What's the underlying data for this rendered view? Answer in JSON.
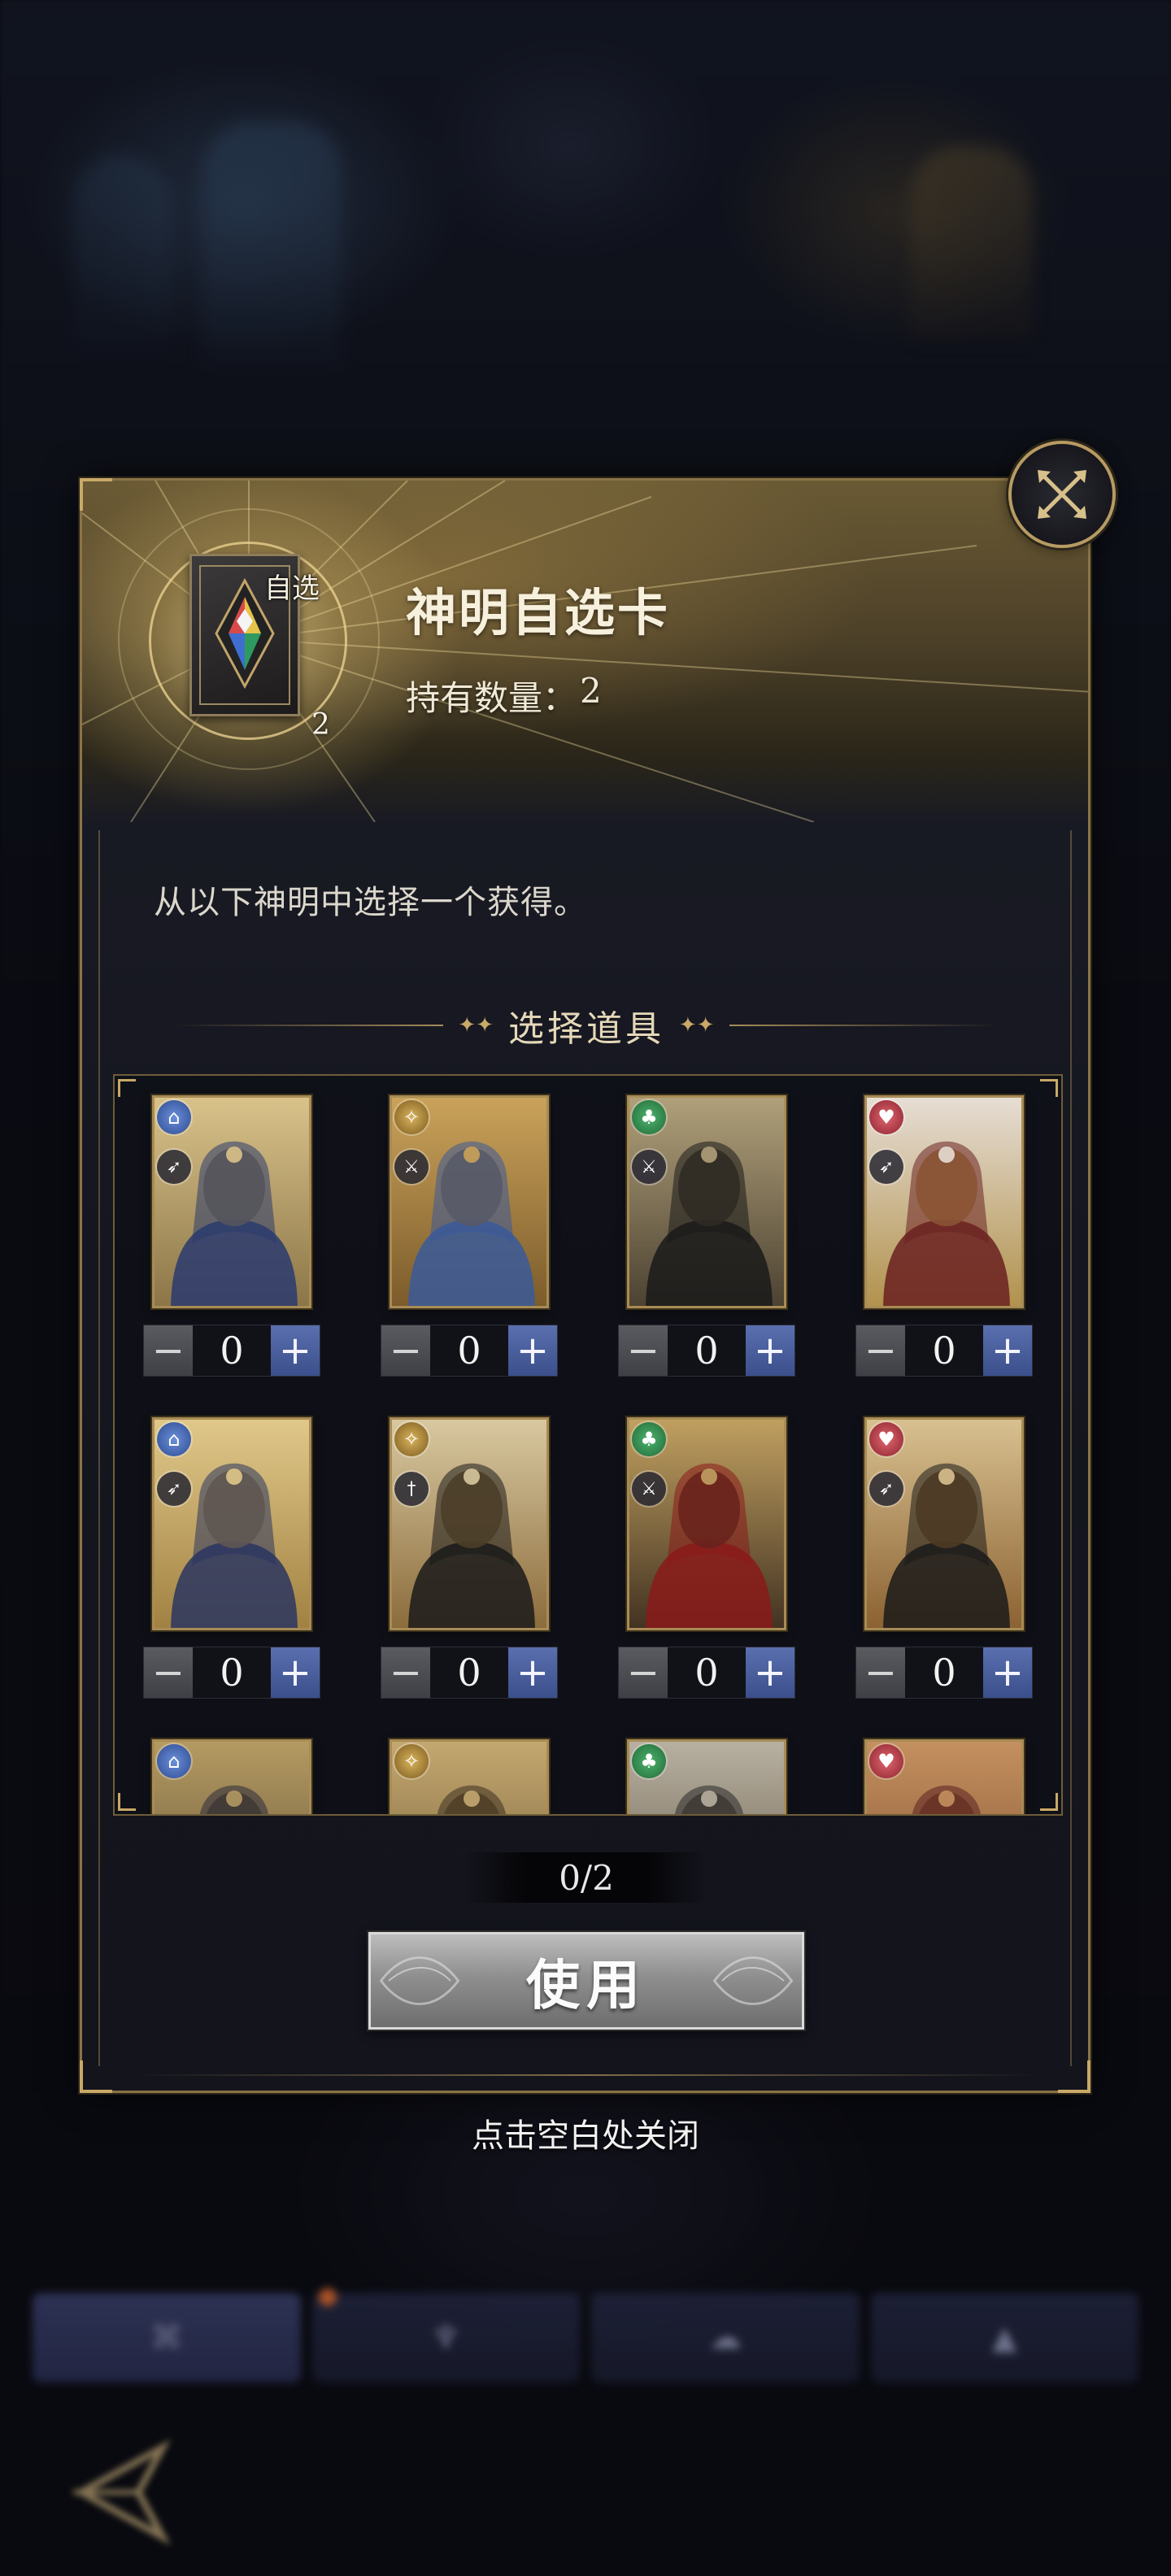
{
  "dialog": {
    "title": "神明自选卡",
    "owned_label": "持有数量：",
    "owned_value": "2",
    "item_tag": "自选",
    "item_count": "2",
    "description": "从以下神明中选择一个获得。",
    "section_title": "选择道具",
    "selected_count": "0/2",
    "use_button_label": "使用",
    "close_hint": "点击空白处关闭"
  },
  "gods": [
    {
      "element": "blue",
      "element_icon": "wind-icon",
      "role_icon": "archer-icon",
      "quantity": "0",
      "portrait": "armored-dark-knight"
    },
    {
      "element": "gold",
      "element_icon": "sun-icon",
      "role_icon": "crossed-swords-icon",
      "quantity": "0",
      "portrait": "golden-headdress-deity"
    },
    {
      "element": "green",
      "element_icon": "clover-icon",
      "role_icon": "crossed-swords-icon",
      "quantity": "0",
      "portrait": "horned-dark-goddess"
    },
    {
      "element": "red",
      "element_icon": "heart-icon",
      "role_icon": "archer-icon",
      "quantity": "0",
      "portrait": "white-haired-goddess"
    },
    {
      "element": "blue",
      "element_icon": "wind-icon",
      "role_icon": "archer-icon",
      "quantity": "0",
      "portrait": "golden-serpent-goddess"
    },
    {
      "element": "gold",
      "element_icon": "sun-icon",
      "role_icon": "dagger-icon",
      "quantity": "0",
      "portrait": "dark-haired-queen"
    },
    {
      "element": "green",
      "element_icon": "clover-icon",
      "role_icon": "crossed-swords-icon",
      "quantity": "0",
      "portrait": "jackal-headed-god"
    },
    {
      "element": "red",
      "element_icon": "heart-icon",
      "role_icon": "archer-icon",
      "quantity": "0",
      "portrait": "veiled-horned-queen"
    },
    {
      "element": "blue",
      "element_icon": "wind-icon",
      "role_icon": "",
      "quantity": "",
      "portrait": "partially-hidden"
    },
    {
      "element": "gold",
      "element_icon": "sun-icon",
      "role_icon": "",
      "quantity": "",
      "portrait": "partially-hidden"
    },
    {
      "element": "green",
      "element_icon": "clover-icon",
      "role_icon": "",
      "quantity": "",
      "portrait": "partially-hidden"
    },
    {
      "element": "red",
      "element_icon": "heart-icon",
      "role_icon": "",
      "quantity": "",
      "portrait": "partially-hidden"
    }
  ],
  "stepper": {
    "minus": "−",
    "plus": "+"
  },
  "colors": {
    "gold_frame": "#a88c55",
    "plus_button": "#4a5f9e",
    "minus_button": "#4f5055",
    "element_blue": "#4a6fc0",
    "element_gold": "#b89040",
    "element_green": "#3a9a58",
    "element_red": "#c04552"
  }
}
